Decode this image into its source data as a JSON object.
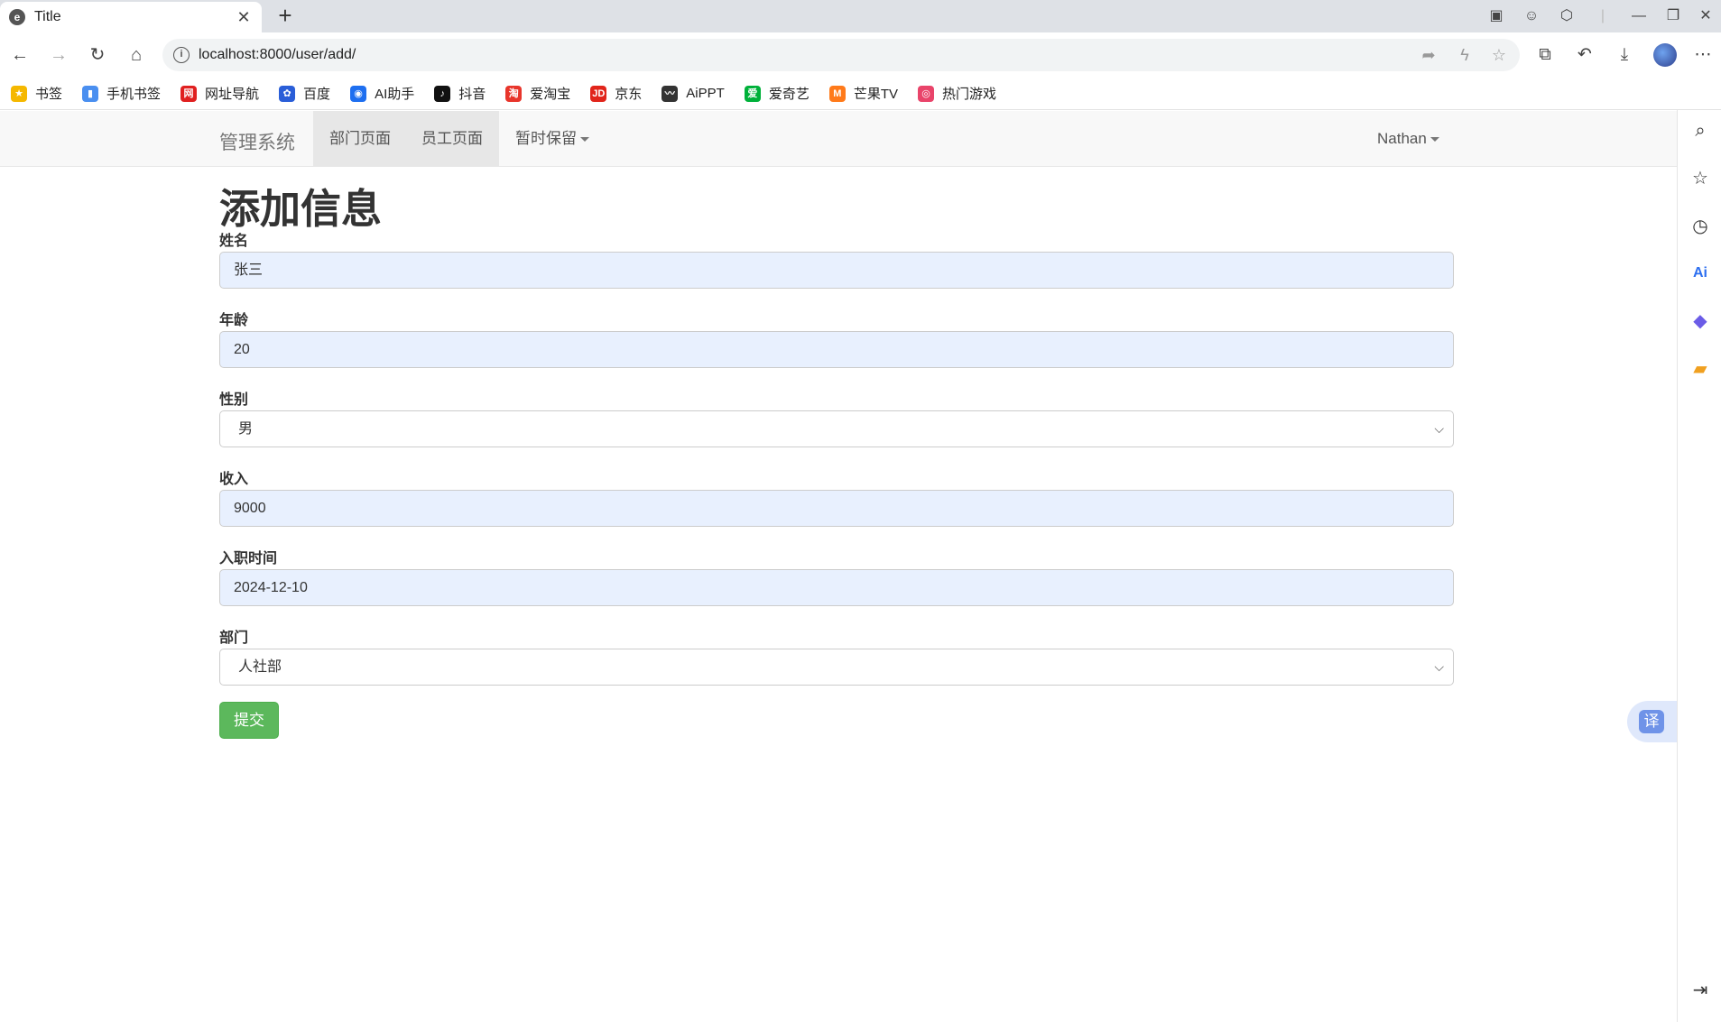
{
  "browser": {
    "tab_title": "Title",
    "tab_close": "✕",
    "new_tab": "+",
    "url": "localhost:8000/user/add/",
    "window_controls": {
      "minimize": "—",
      "restore": "❐",
      "close": "✕"
    },
    "more_menu": "⋯"
  },
  "bookmarks": [
    {
      "label": "书签",
      "icon": "star-icon",
      "color": "#f5b800",
      "glyph": "★"
    },
    {
      "label": "手机书签",
      "icon": "phone-bookmark-icon",
      "color": "#4a8ff0",
      "glyph": "▮"
    },
    {
      "label": "网址导航",
      "icon": "nav-icon",
      "color": "#e02020",
      "glyph": "网"
    },
    {
      "label": "百度",
      "icon": "baidu-icon",
      "color": "#2a5ed8",
      "glyph": "✿"
    },
    {
      "label": "AI助手",
      "icon": "ai-assistant-icon",
      "color": "#1e6ff0",
      "glyph": "◉"
    },
    {
      "label": "抖音",
      "icon": "douyin-icon",
      "color": "#111111",
      "glyph": "♪"
    },
    {
      "label": "爱淘宝",
      "icon": "taobao-icon",
      "color": "#e8352b",
      "glyph": "淘"
    },
    {
      "label": "京东",
      "icon": "jd-icon",
      "color": "#e1251b",
      "glyph": "JD"
    },
    {
      "label": "AiPPT",
      "icon": "aippt-icon",
      "color": "#333333",
      "glyph": "〰"
    },
    {
      "label": "爱奇艺",
      "icon": "iqiyi-icon",
      "color": "#00b13a",
      "glyph": "爱"
    },
    {
      "label": "芒果TV",
      "icon": "mango-icon",
      "color": "#ff7a1a",
      "glyph": "M"
    },
    {
      "label": "热门游戏",
      "icon": "game-icon",
      "color": "#e9446a",
      "glyph": "◎"
    }
  ],
  "navbar": {
    "brand": "管理系统",
    "links": [
      "部门页面",
      "员工页面"
    ],
    "dropdown": "暂时保留",
    "user": "Nathan"
  },
  "form": {
    "title": "添加信息",
    "fields": [
      {
        "label": "姓名",
        "value": "张三",
        "type": "input"
      },
      {
        "label": "年龄",
        "value": "20",
        "type": "input"
      },
      {
        "label": "性别",
        "value": "男",
        "type": "select"
      },
      {
        "label": "收入",
        "value": "9000",
        "type": "input"
      },
      {
        "label": "入职时间",
        "value": "2024-12-10",
        "type": "input"
      },
      {
        "label": "部门",
        "value": "人社部",
        "type": "select"
      }
    ],
    "submit": "提交"
  },
  "translate": {
    "label": "译"
  }
}
